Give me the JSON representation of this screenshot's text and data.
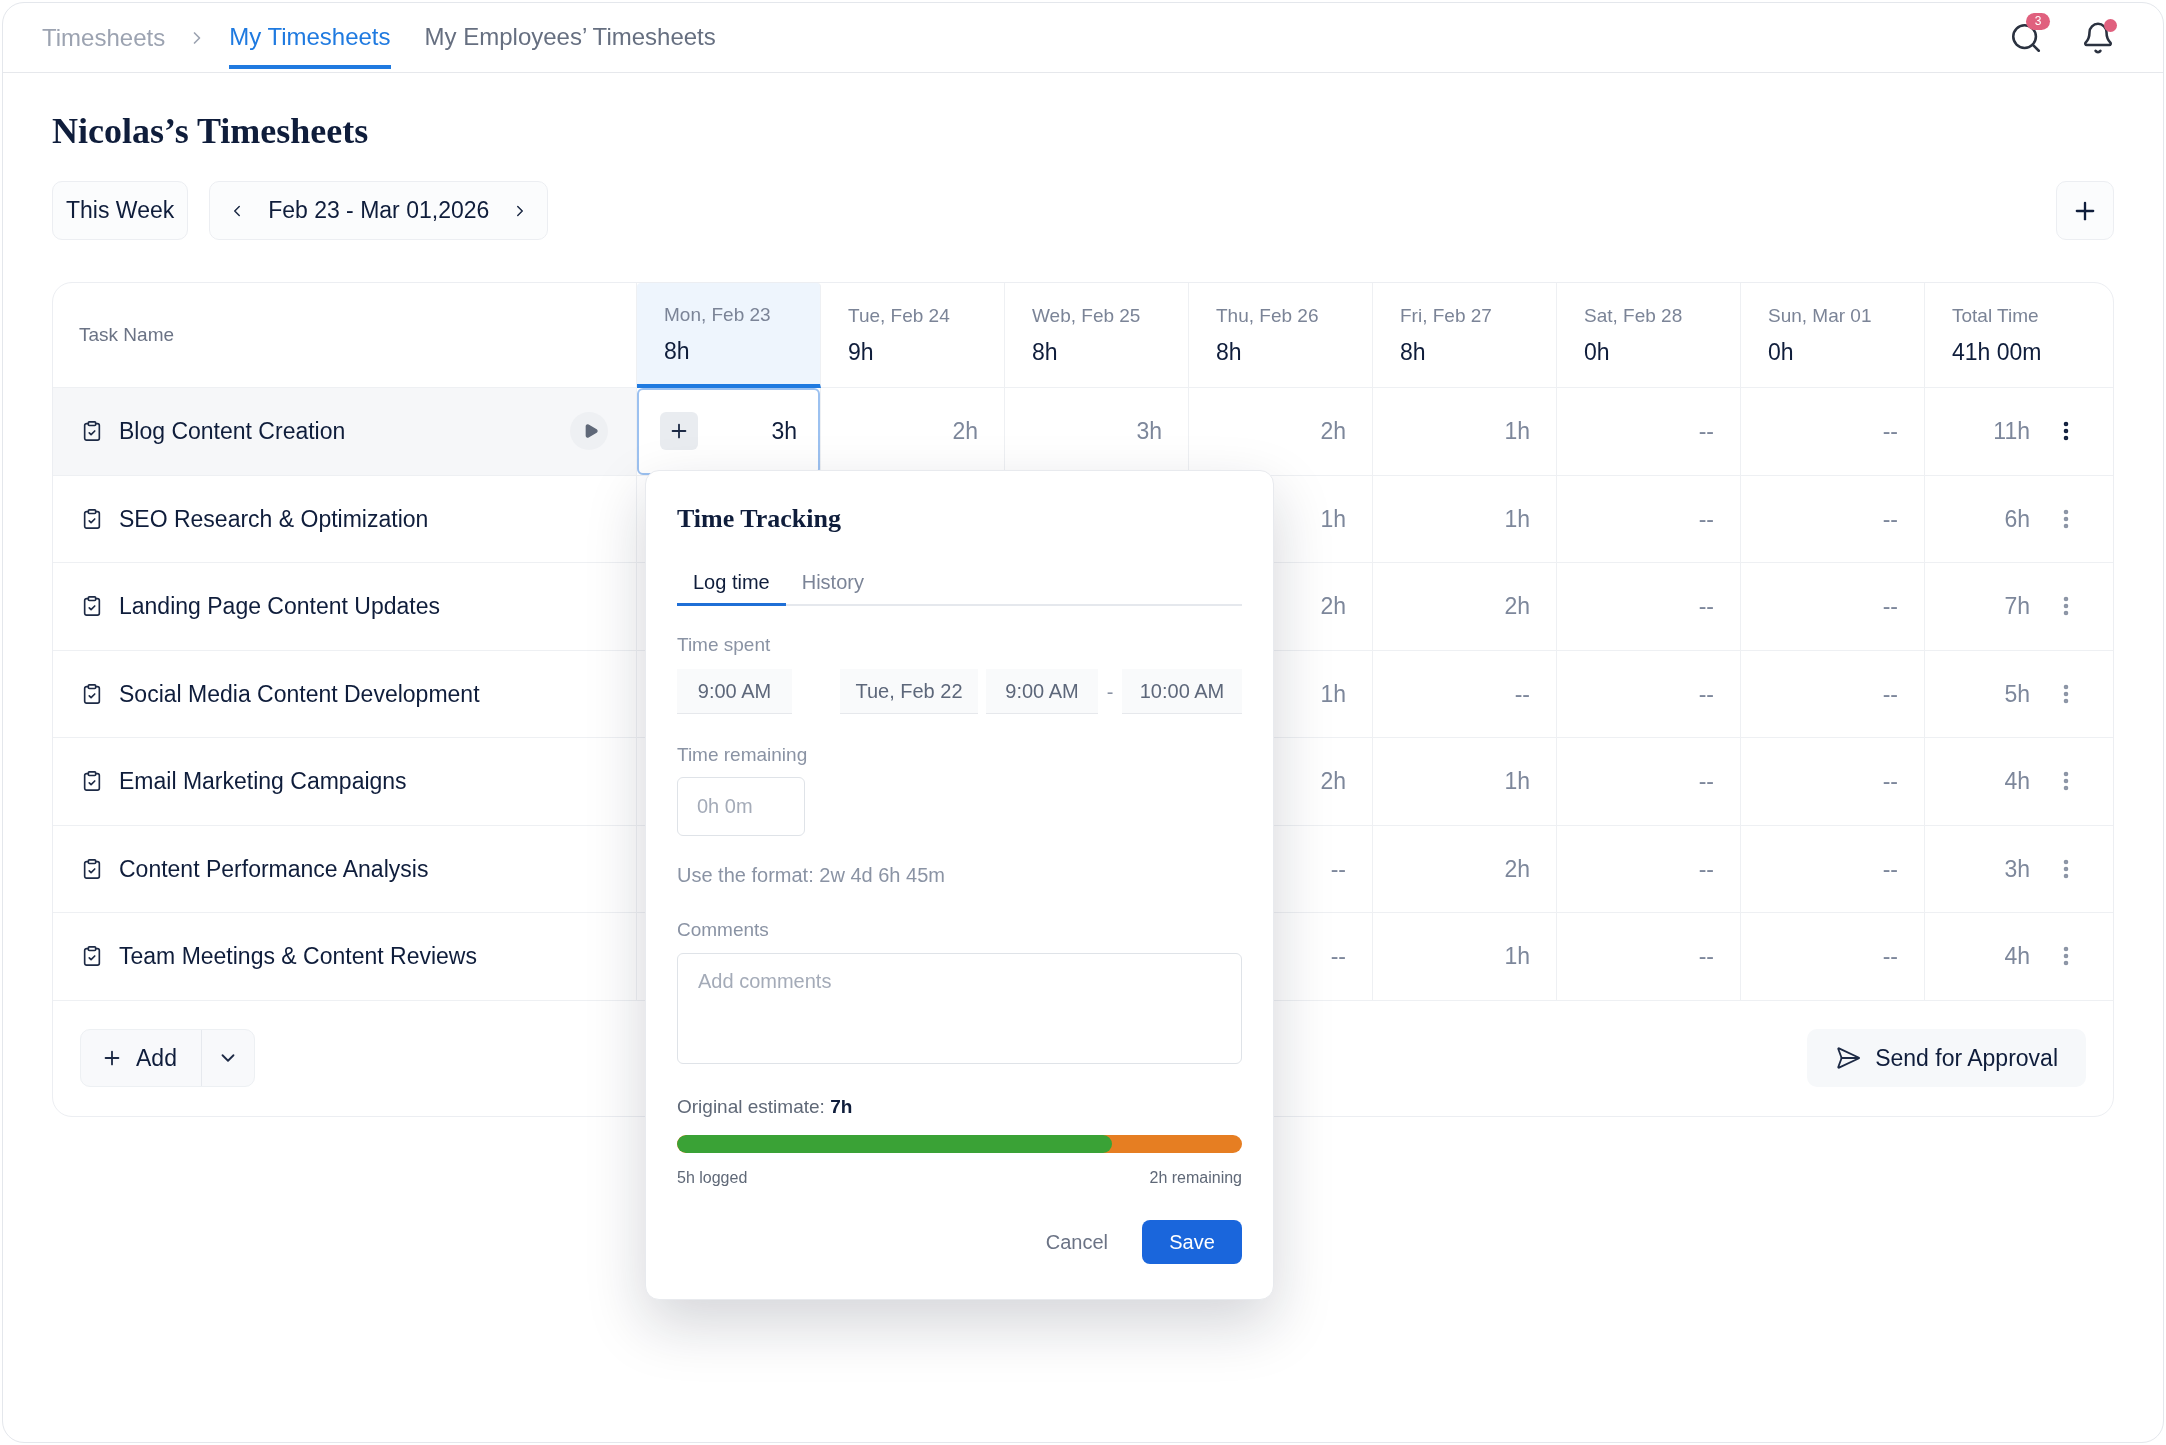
{
  "header": {
    "breadcrumb": "Timesheets",
    "tabs": [
      {
        "label": "My Timesheets",
        "selected": true
      },
      {
        "label": "My Employees’ Timesheets",
        "selected": false
      }
    ],
    "search_badge": "3",
    "notifications_unread": true
  },
  "title": "Nicolas’s Timesheets",
  "week": {
    "button": "This Week",
    "range": "Feb 23 - Mar 01,2026"
  },
  "table": {
    "task_header": "Task Name",
    "columns": [
      {
        "day": "Mon, Feb 23",
        "total": "8h",
        "selected": true
      },
      {
        "day": "Tue, Feb 24",
        "total": "9h",
        "selected": false
      },
      {
        "day": "Web, Feb 25",
        "total": "8h",
        "selected": false
      },
      {
        "day": "Thu, Feb 26",
        "total": "8h",
        "selected": false
      },
      {
        "day": "Fri, Feb 27",
        "total": "8h",
        "selected": false
      },
      {
        "day": "Sat, Feb 28",
        "total": "0h",
        "selected": false
      },
      {
        "day": "Sun, Mar 01",
        "total": "0h",
        "selected": false
      }
    ],
    "total_column": {
      "label": "Total Time",
      "value": "41h 00m"
    },
    "rows": [
      {
        "task": "Blog Content Creation",
        "selected": true,
        "cells": [
          "3h",
          "2h",
          "3h",
          "2h",
          "1h",
          "--",
          "--"
        ],
        "total": "11h"
      },
      {
        "task": "SEO Research & Optimization",
        "selected": false,
        "cells": [
          null,
          null,
          null,
          "1h",
          "1h",
          "--",
          "--"
        ],
        "total": "6h"
      },
      {
        "task": "Landing Page Content Updates",
        "selected": false,
        "cells": [
          null,
          null,
          null,
          "2h",
          "2h",
          "--",
          "--"
        ],
        "total": "7h"
      },
      {
        "task": "Social Media Content Development",
        "selected": false,
        "cells": [
          null,
          null,
          null,
          "1h",
          "--",
          "--",
          "--"
        ],
        "total": "5h"
      },
      {
        "task": "Email Marketing Campaigns",
        "selected": false,
        "cells": [
          null,
          null,
          null,
          "2h",
          "1h",
          "--",
          "--"
        ],
        "total": "4h"
      },
      {
        "task": "Content Performance Analysis",
        "selected": false,
        "cells": [
          null,
          null,
          null,
          "--",
          "2h",
          "--",
          "--"
        ],
        "total": "3h"
      },
      {
        "task": "Team Meetings & Content Reviews",
        "selected": false,
        "cells": [
          null,
          null,
          null,
          "--",
          "1h",
          "--",
          "--"
        ],
        "total": "4h"
      }
    ]
  },
  "footer": {
    "add_button": "Add",
    "send_button": "Send for Approval"
  },
  "time_tracking": {
    "title": "Time Tracking",
    "tabs": [
      {
        "label": "Log time",
        "selected": true
      },
      {
        "label": "History",
        "selected": false
      }
    ],
    "time_spent": {
      "label": "Time spent",
      "start": "9:00 AM",
      "date": "Tue, Feb 22",
      "from": "9:00 AM",
      "separator": "-",
      "to": "10:00 AM"
    },
    "time_remaining": {
      "label": "Time remaining",
      "placeholder": "0h 0m"
    },
    "hint": "Use the format: 2w 4d 6h 45m",
    "comments": {
      "label": "Comments",
      "placeholder": "Add comments"
    },
    "estimate": "Original estimate: **7h**",
    "progress": {
      "level": 0.77,
      "logged": "5h logged",
      "remaining": "2h remaining"
    },
    "buttons": [
      {
        "label": "Cancel",
        "kind": "secondary"
      },
      {
        "label": "Save",
        "kind": "primary"
      }
    ]
  }
}
